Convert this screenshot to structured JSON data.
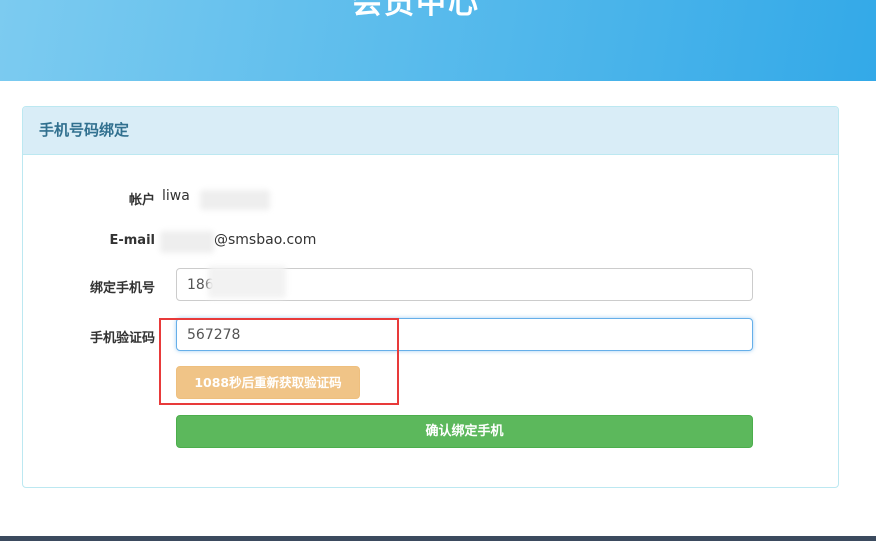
{
  "header": {
    "title": "会员中心"
  },
  "panel": {
    "heading": "手机号码绑定"
  },
  "form": {
    "account_label": "帐户",
    "account_value": "liwa",
    "email_label": "E-mail",
    "email_value": "@smsbao.com",
    "phone_label": "绑定手机号",
    "phone_value": "186",
    "code_label": "手机验证码",
    "code_value": "567278",
    "resend_button": "1088秒后重新获取验证码",
    "confirm_button": "确认绑定手机"
  },
  "colors": {
    "banner": "#5bbcec",
    "panel_heading_bg": "#d9edf7",
    "resend_button_bg": "#f0c487",
    "confirm_button_bg": "#5cb85c",
    "highlight": "#e83a3a"
  }
}
